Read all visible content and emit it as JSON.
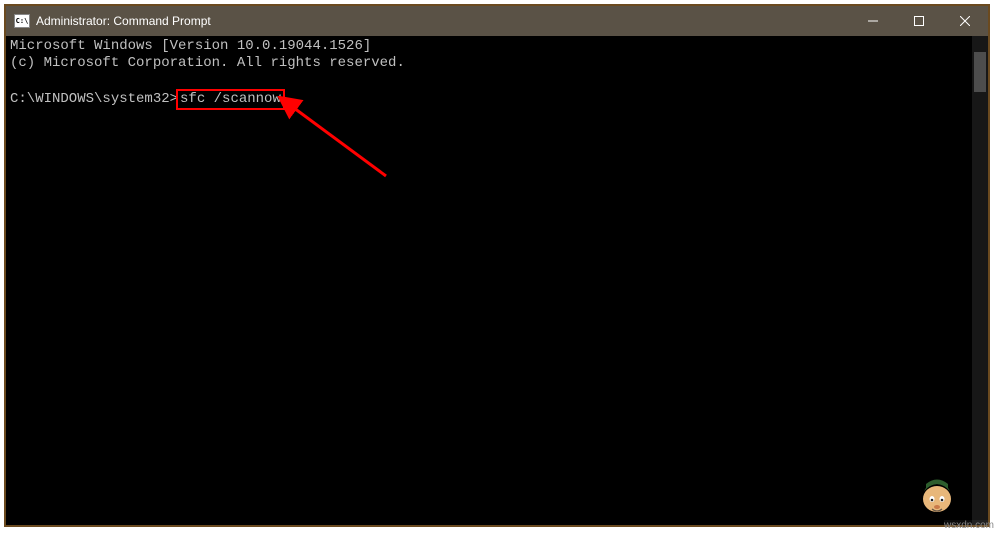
{
  "titlebar": {
    "icon_label": "C:\\",
    "title": "Administrator: Command Prompt"
  },
  "terminal": {
    "line1": "Microsoft Windows [Version 10.0.19044.1526]",
    "line2": "(c) Microsoft Corporation. All rights reserved.",
    "prompt": "C:\\WINDOWS\\system32>",
    "command": "sfc /scannow"
  },
  "watermark": "wsxdn.com"
}
